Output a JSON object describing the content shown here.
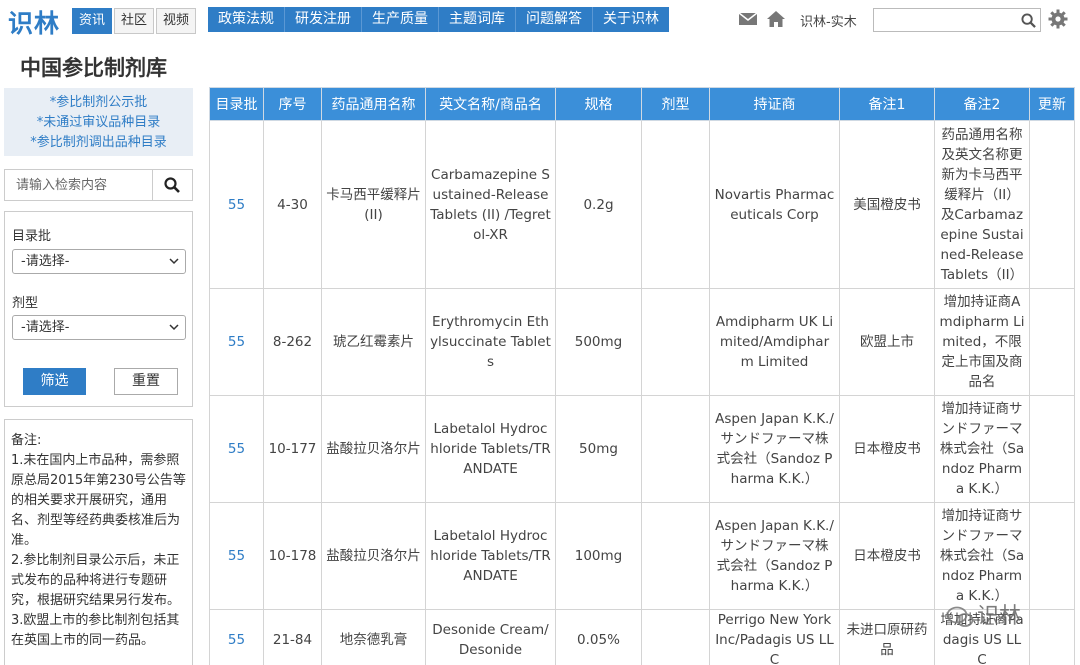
{
  "logo": "识林",
  "mini_tabs": [
    {
      "label": "资讯",
      "active": true
    },
    {
      "label": "社区",
      "active": false
    },
    {
      "label": "视频",
      "active": false
    }
  ],
  "nav": [
    "政策法规",
    "研发注册",
    "生产质量",
    "主题词库",
    "问题解答",
    "关于识林"
  ],
  "header": {
    "icons": [
      "mail-icon",
      "home-icon"
    ],
    "user": "识林-实木",
    "search_placeholder": "",
    "settings_icon": "gear-icon"
  },
  "page_title": "中国参比制剂库",
  "sidebar": {
    "links": [
      "*参比制剂公示批",
      "*未通过审议品种目录",
      "*参比制剂调出品种目录"
    ],
    "search_placeholder": "请输入检索内容",
    "filter": {
      "batch_label": "目录批",
      "batch_value": "-请选择-",
      "form_label": "剂型",
      "form_value": "-请选择-",
      "filter_button": "筛选",
      "reset_button": "重置"
    },
    "notes": {
      "heading": "备注:",
      "items": [
        "1.未在国内上市品种，需参照原总局2015年第230号公告等的相关要求开展研究，通用名、剂型等经药典委核准后为准。",
        "2.参比制剂目录公示后，未正式发布的品种将进行专题研究，根据研究结果另行发布。",
        "3.欧盟上市的参比制剂包括其在英国上市的同一药品。"
      ]
    }
  },
  "table": {
    "headers": [
      "目录批",
      "序号",
      "药品通用名称",
      "英文名称/商品名",
      "规格",
      "剂型",
      "持证商",
      "备注1",
      "备注2",
      "更新"
    ],
    "rows": [
      {
        "batch": "55",
        "seq": "4-30",
        "cn_name": "卡马西平缓释片(II)",
        "en_name": "Carbamazepine Sustained-Release Tablets (II) /Tegretol-XR",
        "spec": "0.2g",
        "form": "",
        "holder": "Novartis Pharmaceuticals Corp",
        "note1": "美国橙皮书",
        "note2": "药品通用名称及英文名称更新为卡马西平缓释片（II）及Carbamazepine Sustained-Release Tablets（II）",
        "update": ""
      },
      {
        "batch": "55",
        "seq": "8-262",
        "cn_name": "琥乙红霉素片",
        "en_name": "Erythromycin Ethylsuccinate Tablets",
        "spec": "500mg",
        "form": "",
        "holder": "Amdipharm UK Limited/Amdipharm Limited",
        "note1": "欧盟上市",
        "note2": "增加持证商Amdipharm Limited，不限定上市国及商品名",
        "update": ""
      },
      {
        "batch": "55",
        "seq": "10-177",
        "cn_name": "盐酸拉贝洛尔片",
        "en_name": "Labetalol Hydrochloride Tablets/TRANDATE",
        "spec": "50mg",
        "form": "",
        "holder": "Aspen Japan K.K./サンドファーマ株式会社（Sandoz Pharma K.K.）",
        "note1": "日本橙皮书",
        "note2": "增加持证商サンドファーマ株式会社（Sandoz Pharma K.K.）",
        "update": ""
      },
      {
        "batch": "55",
        "seq": "10-178",
        "cn_name": "盐酸拉贝洛尔片",
        "en_name": "Labetalol Hydrochloride Tablets/TRANDATE",
        "spec": "100mg",
        "form": "",
        "holder": "Aspen Japan K.K./サンドファーマ株式会社（Sandoz Pharma K.K.）",
        "note1": "日本橙皮书",
        "note2": "增加持证商サンドファーマ株式会社（Sandoz Pharma K.K.）",
        "update": ""
      },
      {
        "batch": "55",
        "seq": "21-84",
        "cn_name": "地奈德乳膏",
        "en_name": "Desonide Cream/Desonide",
        "spec": "0.05%",
        "form": "",
        "holder": "Perrigo New York Inc/Padagis US LLC",
        "note1": "未进口原研药品",
        "note2": "增加持证商Padagis US LLC",
        "update": ""
      }
    ]
  },
  "watermark": "识林",
  "colors": {
    "accent": "#2f7dc6",
    "header_bg": "#3b8fd9",
    "sidebar_bg": "#e8eef5"
  }
}
